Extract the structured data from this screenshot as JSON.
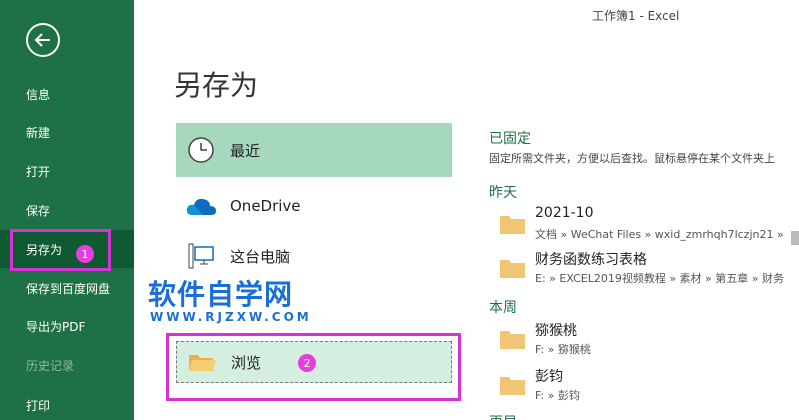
{
  "window": {
    "title": "工作簿1  -  Excel"
  },
  "sidebar": {
    "back_icon": "back-arrow-icon",
    "items": [
      {
        "label": "信息"
      },
      {
        "label": "新建"
      },
      {
        "label": "打开"
      },
      {
        "label": "保存"
      },
      {
        "label": "另存为"
      },
      {
        "label": "保存到百度网盘"
      },
      {
        "label": "导出为PDF"
      },
      {
        "label": "历史记录"
      },
      {
        "label": "打印"
      }
    ]
  },
  "main": {
    "title": "另存为",
    "locations": [
      {
        "label": "最近",
        "icon": "clock-icon"
      },
      {
        "label": "OneDrive",
        "icon": "cloud-icon"
      },
      {
        "label": "这台电脑",
        "icon": "computer-icon"
      },
      {
        "label": "浏览",
        "icon": "folder-icon"
      }
    ],
    "pinned": {
      "heading": "已固定",
      "description": "固定所需文件夹，方便以后查找。鼠标悬停在某个文件夹上"
    },
    "yesterday": {
      "heading": "昨天",
      "folders": [
        {
          "name": "2021-10",
          "path": "文档 » WeChat Files » wxid_zmrhqh7lczjn21 »"
        },
        {
          "name": "财务函数练习表格",
          "path": "E: » EXCEL2019视频教程 » 素材 » 第五章 » 财务"
        }
      ]
    },
    "this_week": {
      "heading": "本周",
      "folders": [
        {
          "name": "猕猴桃",
          "path": "F: » 猕猴桃"
        },
        {
          "name": "彭钧",
          "path": "F: » 彭钧"
        }
      ]
    },
    "next_heading": "更早"
  },
  "annotations": {
    "badge1": "1",
    "badge2": "2"
  },
  "watermark": {
    "text": "软件自学网",
    "url": "WWW.RJZXW.COM"
  },
  "colors": {
    "sidebar": "#1e7145",
    "selected": "#a6d8bd",
    "highlight": "#d633d6"
  }
}
